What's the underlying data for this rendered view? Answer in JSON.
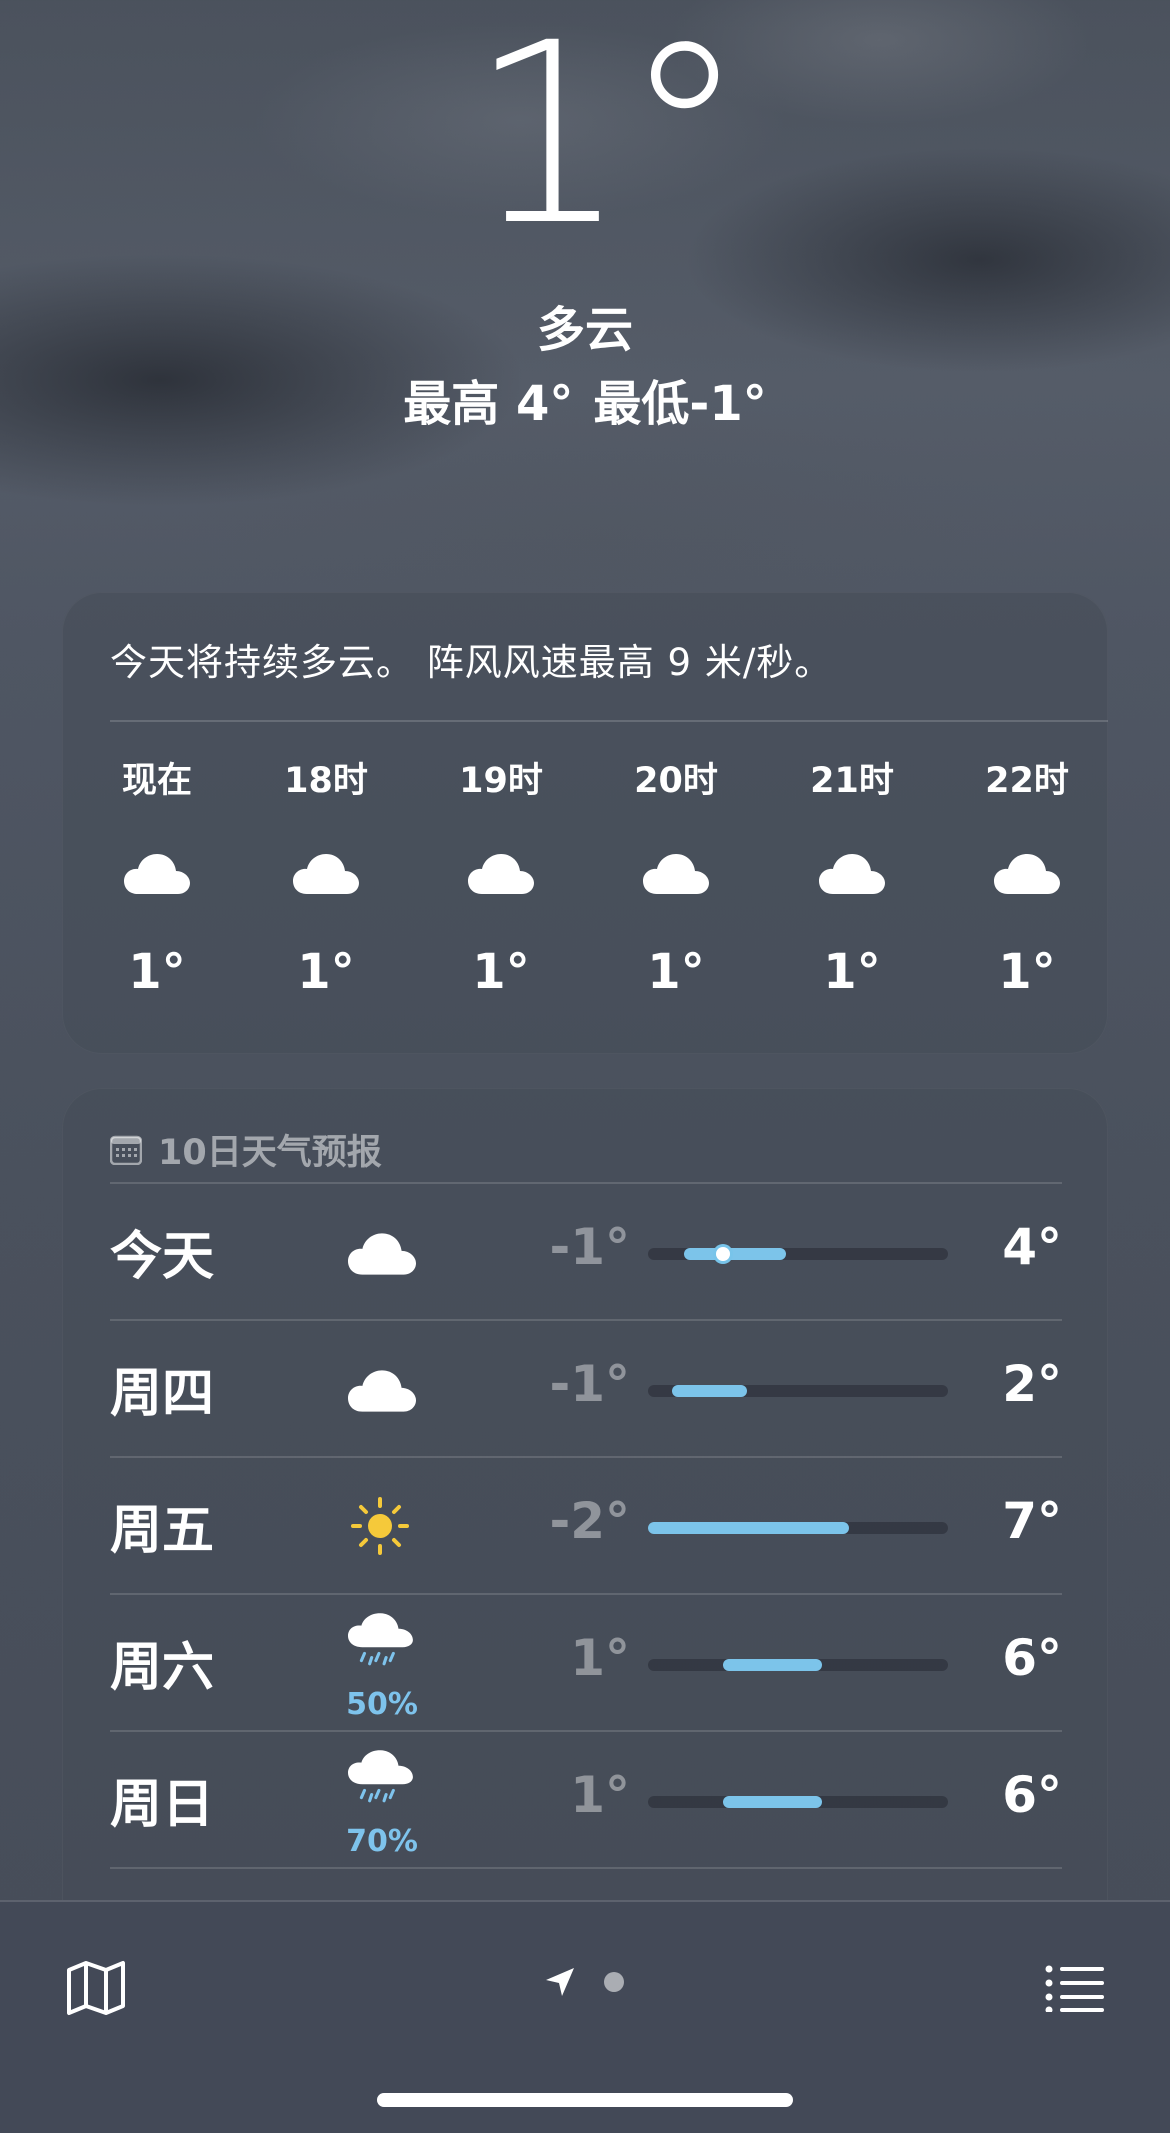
{
  "current": {
    "temperature": "1°",
    "condition": "多云",
    "high_label": "最高 4°",
    "low_label": "最低-1°"
  },
  "hourly": {
    "summary": "今天将持续多云。 阵风风速最高 9 米/秒。",
    "hours": [
      {
        "label": "现在",
        "icon": "cloud-icon",
        "temp": "1°"
      },
      {
        "label": "18时",
        "icon": "cloud-icon",
        "temp": "1°"
      },
      {
        "label": "19时",
        "icon": "cloud-icon",
        "temp": "1°"
      },
      {
        "label": "20时",
        "icon": "cloud-icon",
        "temp": "1°"
      },
      {
        "label": "21时",
        "icon": "cloud-icon",
        "temp": "1°"
      },
      {
        "label": "22时",
        "icon": "cloud-icon",
        "temp": "1°"
      }
    ]
  },
  "daily": {
    "title": "10日天气预报",
    "days": [
      {
        "name": "今天",
        "icon": "cloud-icon",
        "precip": "",
        "low": "-1°",
        "high": "4°",
        "range_start": 0.12,
        "range_end": 0.46,
        "current_marker": 0.25
      },
      {
        "name": "周四",
        "icon": "cloud-icon",
        "precip": "",
        "low": "-1°",
        "high": "2°",
        "range_start": 0.08,
        "range_end": 0.33,
        "current_marker": null
      },
      {
        "name": "周五",
        "icon": "sun-icon",
        "precip": "",
        "low": "-2°",
        "high": "7°",
        "range_start": 0.0,
        "range_end": 0.67,
        "current_marker": null
      },
      {
        "name": "周六",
        "icon": "rain-cloud-icon",
        "precip": "50%",
        "low": "1°",
        "high": "6°",
        "range_start": 0.25,
        "range_end": 0.58,
        "current_marker": null
      },
      {
        "name": "周日",
        "icon": "rain-cloud-icon",
        "precip": "70%",
        "low": "1°",
        "high": "6°",
        "range_start": 0.25,
        "range_end": 0.58,
        "current_marker": null
      }
    ]
  },
  "toolbar": {
    "map_icon": "map-icon",
    "location_icon": "location-arrow-icon",
    "list_icon": "list-icon"
  },
  "colors": {
    "bar_fill": "#7cc4ea",
    "precip_text": "#7ec3ec",
    "sun": "#f5c93a"
  }
}
